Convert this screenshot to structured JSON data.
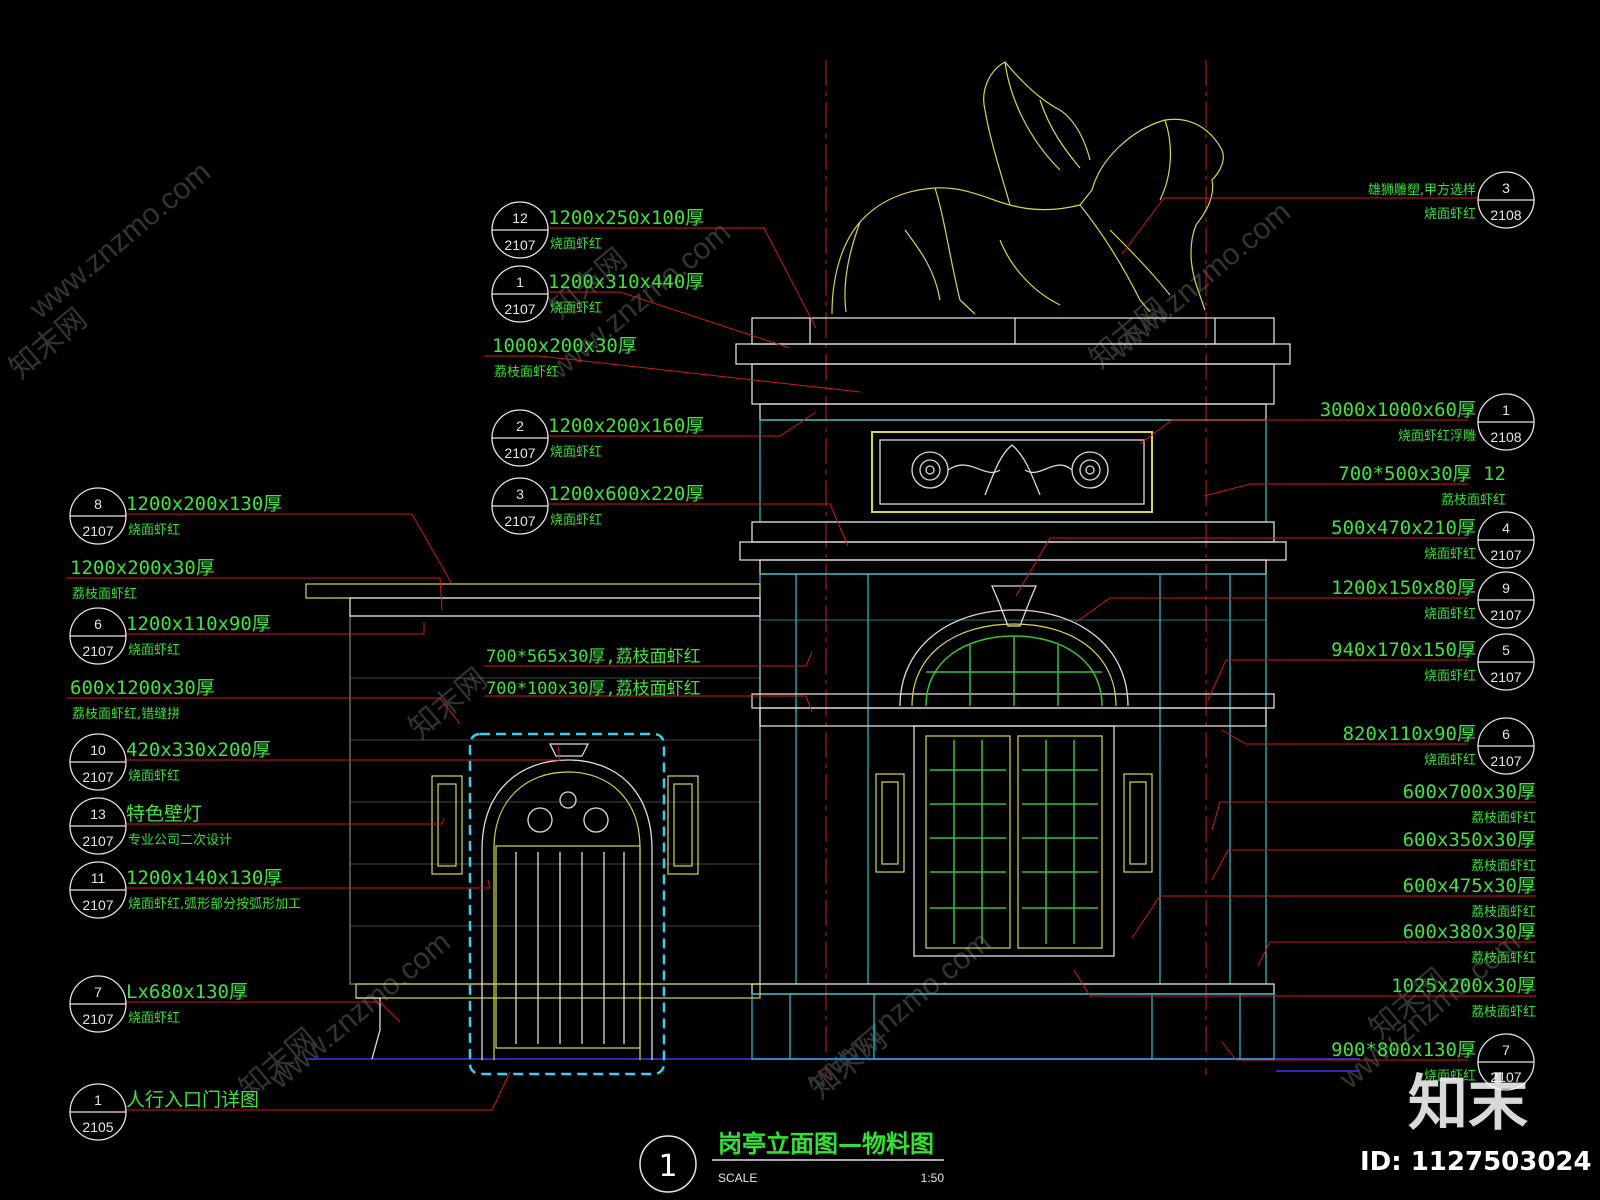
{
  "title": "岗亭立面图—物料图",
  "view_number": "1",
  "scale_label": "SCALE",
  "scale_value": "1:50",
  "watermark_site": "www.znzmo.com",
  "watermark_brand": "知末网",
  "brand_logo": "知末",
  "image_id": "ID: 1127503024",
  "left_callouts": [
    {
      "num": "12",
      "sheet": "2107",
      "dim": "1200x250x100厚",
      "mat": "烧面虾红"
    },
    {
      "num": "1",
      "sheet": "2107",
      "dim": "1200x310x440厚",
      "mat": "烧面虾红"
    },
    {
      "num": "",
      "sheet": "",
      "dim": "1000x200x30厚",
      "mat": "荔枝面虾红"
    },
    {
      "num": "2",
      "sheet": "2107",
      "dim": "1200x200x160厚",
      "mat": "烧面虾红"
    },
    {
      "num": "3",
      "sheet": "2107",
      "dim": "1200x600x220厚",
      "mat": "烧面虾红"
    },
    {
      "num": "8",
      "sheet": "2107",
      "dim": "1200x200x130厚",
      "mat": "烧面虾红"
    },
    {
      "num": "",
      "sheet": "",
      "dim": "1200x200x30厚",
      "mat": "荔枝面虾红"
    },
    {
      "num": "6",
      "sheet": "2107",
      "dim": "1200x110x90厚",
      "mat": "烧面虾红"
    },
    {
      "num": "",
      "sheet": "",
      "dim": "600x1200x30厚",
      "mat": "荔枝面虾红,错缝拼"
    },
    {
      "num": "10",
      "sheet": "2107",
      "dim": "420x330x200厚",
      "mat": "烧面虾红"
    },
    {
      "num": "13",
      "sheet": "2107",
      "dim": "特色壁灯",
      "mat": "专业公司二次设计"
    },
    {
      "num": "11",
      "sheet": "2107",
      "dim": "1200x140x130厚",
      "mat": "烧面虾红,弧形部分按弧形加工"
    },
    {
      "num": "7",
      "sheet": "2107",
      "dim": "Lx680x130厚",
      "mat": "烧面虾红"
    },
    {
      "num": "1",
      "sheet": "2105",
      "dim": "人行入口门详图",
      "mat": ""
    }
  ],
  "center_notes": [
    "700*565x30厚,荔枝面虾红",
    "700*100x30厚,荔枝面虾红"
  ],
  "right_callouts": [
    {
      "num": "3",
      "sheet": "2108",
      "dim": "雄狮雕塑,甲方选样",
      "mat": "烧面虾红"
    },
    {
      "num": "1",
      "sheet": "2108",
      "dim": "3000x1000x60厚",
      "mat": "烧面虾红浮雕"
    },
    {
      "num": "",
      "sheet": "",
      "dim": "700*500x30厚 12",
      "mat": "荔枝面虾红"
    },
    {
      "num": "4",
      "sheet": "2107",
      "dim": "500x470x210厚",
      "mat": "烧面虾红"
    },
    {
      "num": "9",
      "sheet": "2107",
      "dim": "1200x150x80厚",
      "mat": "烧面虾红"
    },
    {
      "num": "5",
      "sheet": "2107",
      "dim": "940x170x150厚",
      "mat": "烧面虾红"
    },
    {
      "num": "6",
      "sheet": "2107",
      "dim": "820x110x90厚",
      "mat": "烧面虾红"
    },
    {
      "num": "",
      "sheet": "",
      "dim": "600x700x30厚",
      "mat": "荔枝面虾红"
    },
    {
      "num": "",
      "sheet": "",
      "dim": "600x350x30厚",
      "mat": "荔枝面虾红"
    },
    {
      "num": "",
      "sheet": "",
      "dim": "600x475x30厚",
      "mat": "荔枝面虾红"
    },
    {
      "num": "",
      "sheet": "",
      "dim": "600x380x30厚",
      "mat": "荔枝面虾红"
    },
    {
      "num": "",
      "sheet": "",
      "dim": "1025x200x30厚",
      "mat": "荔枝面虾红"
    },
    {
      "num": "7",
      "sheet": "2107",
      "dim": "900*800x130厚",
      "mat": "烧面虾红"
    }
  ]
}
